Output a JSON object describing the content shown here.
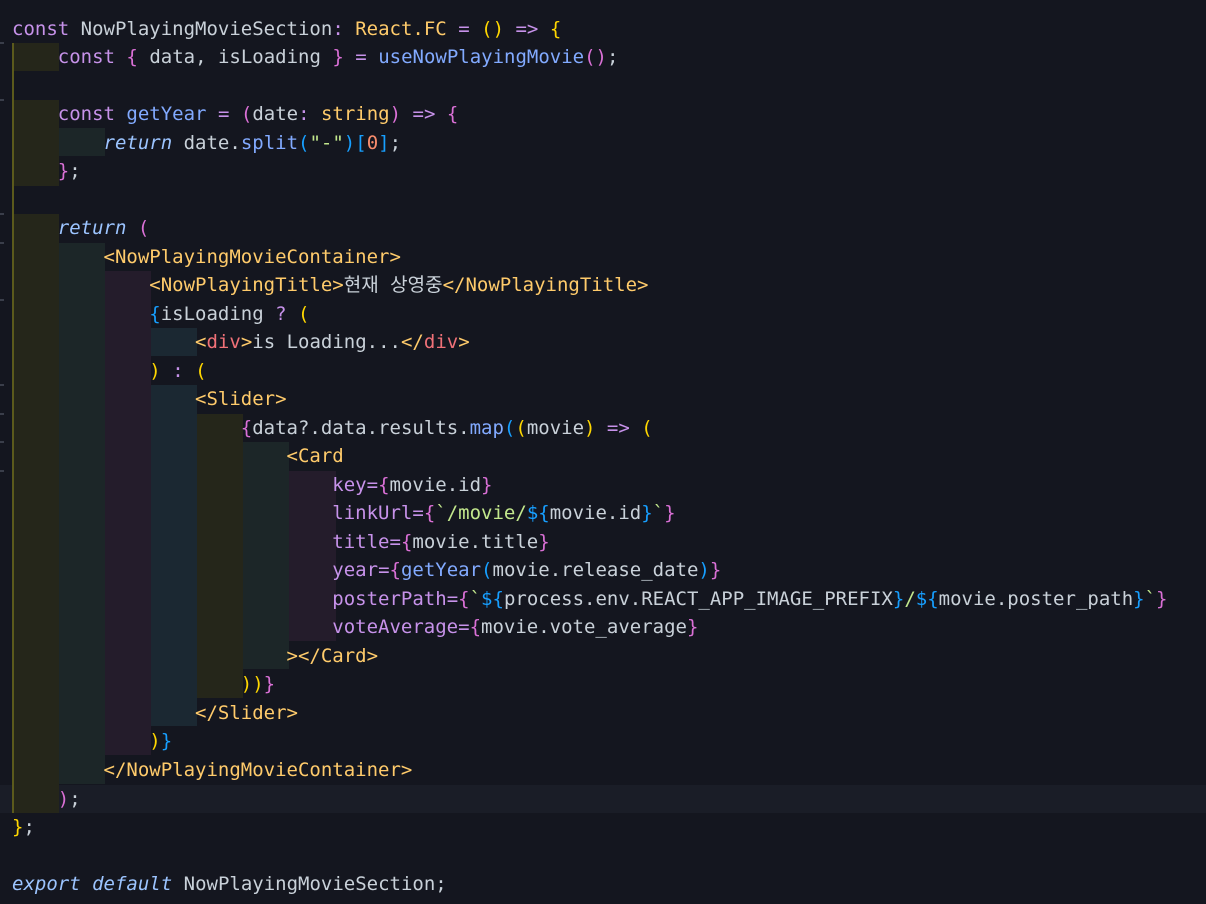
{
  "code": {
    "l1": {
      "kw": "const",
      "name": "NowPlayingMovieSection",
      "colon": ":",
      "type": "React.FC",
      "eq": "=",
      "open": "(",
      "close": ")",
      "arrow": "=>",
      "brace": "{"
    },
    "l2": {
      "kw": "const",
      "b1": "{",
      "vars": "data, isLoading",
      "b2": "}",
      "eq": "=",
      "fn": "useNowPlayingMovie",
      "call": "()",
      "semi": ";"
    },
    "l4": {
      "kw": "const",
      "fn": "getYear",
      "eq": "=",
      "p1": "(",
      "param": "date",
      "colon": ":",
      "type": "string",
      "p2": ")",
      "arrow": "=>",
      "brace": "{"
    },
    "l5": {
      "kw": "return",
      "obj": "date.",
      "fn": "split",
      "p1": "(",
      "str": "\"-\"",
      "p2": ")",
      "b1": "[",
      "num": "0",
      "b2": "]",
      "semi": ";"
    },
    "l6": {
      "brace": "}",
      "semi": ";"
    },
    "l8": {
      "kw": "return",
      "p": "("
    },
    "l9": {
      "tag": "<NowPlayingMovieContainer>"
    },
    "l10": {
      "open": "<NowPlayingTitle>",
      "text": "현재 상영중",
      "close": "</NowPlayingTitle>"
    },
    "l11": {
      "brace": "{",
      "var": "isLoading",
      "q": "?",
      "p": "("
    },
    "l12": {
      "lt": "<",
      "tag": "div",
      "gt": ">",
      "text": "is Loading...",
      "lt2": "</",
      "tag2": "div",
      "gt2": ">"
    },
    "l13": {
      "p": ")",
      "c": ":",
      "p2": "("
    },
    "l14": {
      "tag": "<Slider>"
    },
    "l15": {
      "b": "{",
      "expr": "data?.data.results.",
      "fn": "map",
      "p1": "(",
      "p2": "(",
      "param": "movie",
      "p3": ")",
      "arrow": "=>",
      "p4": "("
    },
    "l16": {
      "tag": "<Card"
    },
    "l17": {
      "attr": "key",
      "eq": "=",
      "b1": "{",
      "val": "movie.id",
      "b2": "}"
    },
    "l18": {
      "attr": "linkUrl",
      "eq": "=",
      "b1": "{",
      "bt": "`",
      "str": "/movie/",
      "d": "${",
      "val": "movie.id",
      "dc": "}",
      "bt2": "`",
      "b2": "}"
    },
    "l19": {
      "attr": "title",
      "eq": "=",
      "b1": "{",
      "val": "movie.title",
      "b2": "}"
    },
    "l20": {
      "attr": "year",
      "eq": "=",
      "b1": "{",
      "fn": "getYear",
      "p1": "(",
      "val": "movie.release_date",
      "p2": ")",
      "b2": "}"
    },
    "l21": {
      "attr": "posterPath",
      "eq": "=",
      "b1": "{",
      "bt": "`",
      "d1": "${",
      "val1": "process.env.REACT_APP_IMAGE_PREFIX",
      "dc1": "}",
      "slash": "/",
      "d2": "${",
      "val2": "movie.poster_path",
      "dc2": "}",
      "bt2": "`",
      "b2": "}"
    },
    "l22": {
      "attr": "voteAverage",
      "eq": "=",
      "b1": "{",
      "val": "movie.vote_average",
      "b2": "}"
    },
    "l23": {
      "tag": "></Card>"
    },
    "l24": {
      "p": "))",
      "b": "}"
    },
    "l25": {
      "tag": "</Slider>"
    },
    "l26": {
      "p": ")",
      "b": "}"
    },
    "l27": {
      "tag": "</NowPlayingMovieContainer>"
    },
    "l28": {
      "p": ")",
      "semi": ";"
    },
    "l29": {
      "brace": "}",
      "semi": ";"
    },
    "l31": {
      "kw1": "export",
      "kw2": "default",
      "name": "NowPlayingMovieSection",
      "semi": ";"
    }
  }
}
